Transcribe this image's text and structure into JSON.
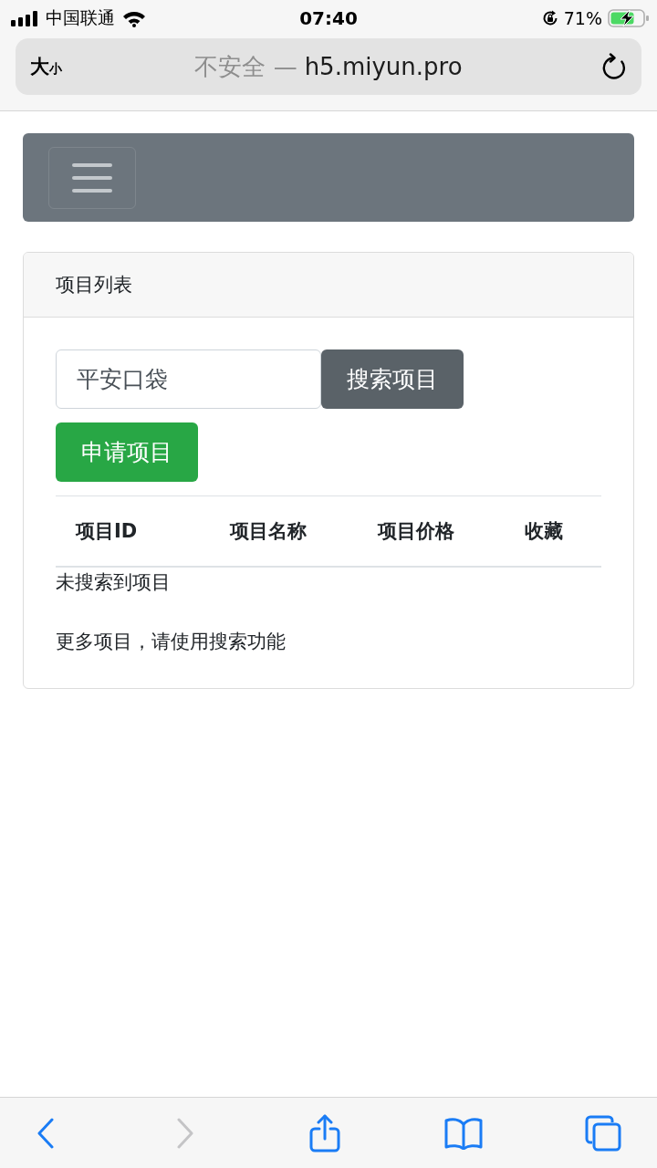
{
  "status_bar": {
    "carrier": "中国联通",
    "time": "07:40",
    "battery": "71%",
    "charging": true
  },
  "address_bar": {
    "text_size": {
      "large": "大",
      "small": "小"
    },
    "security": "不安全 —",
    "domain": "h5.miyun.pro"
  },
  "card": {
    "title": "项目列表",
    "search": {
      "value": "平安口袋"
    },
    "search_button": "搜索项目",
    "apply_button": "申请项目",
    "table": {
      "columns": [
        "项目ID",
        "项目名称",
        "项目价格",
        "收藏"
      ],
      "empty_message": "未搜索到项目"
    },
    "note": "更多项目，请使用搜索功能"
  },
  "toolbar": [
    {
      "kind": "back",
      "disabled": false
    },
    {
      "kind": "forward",
      "disabled": true
    },
    {
      "kind": "share",
      "disabled": false
    },
    {
      "kind": "bookmarks",
      "disabled": false
    },
    {
      "kind": "tabs",
      "disabled": false
    }
  ]
}
